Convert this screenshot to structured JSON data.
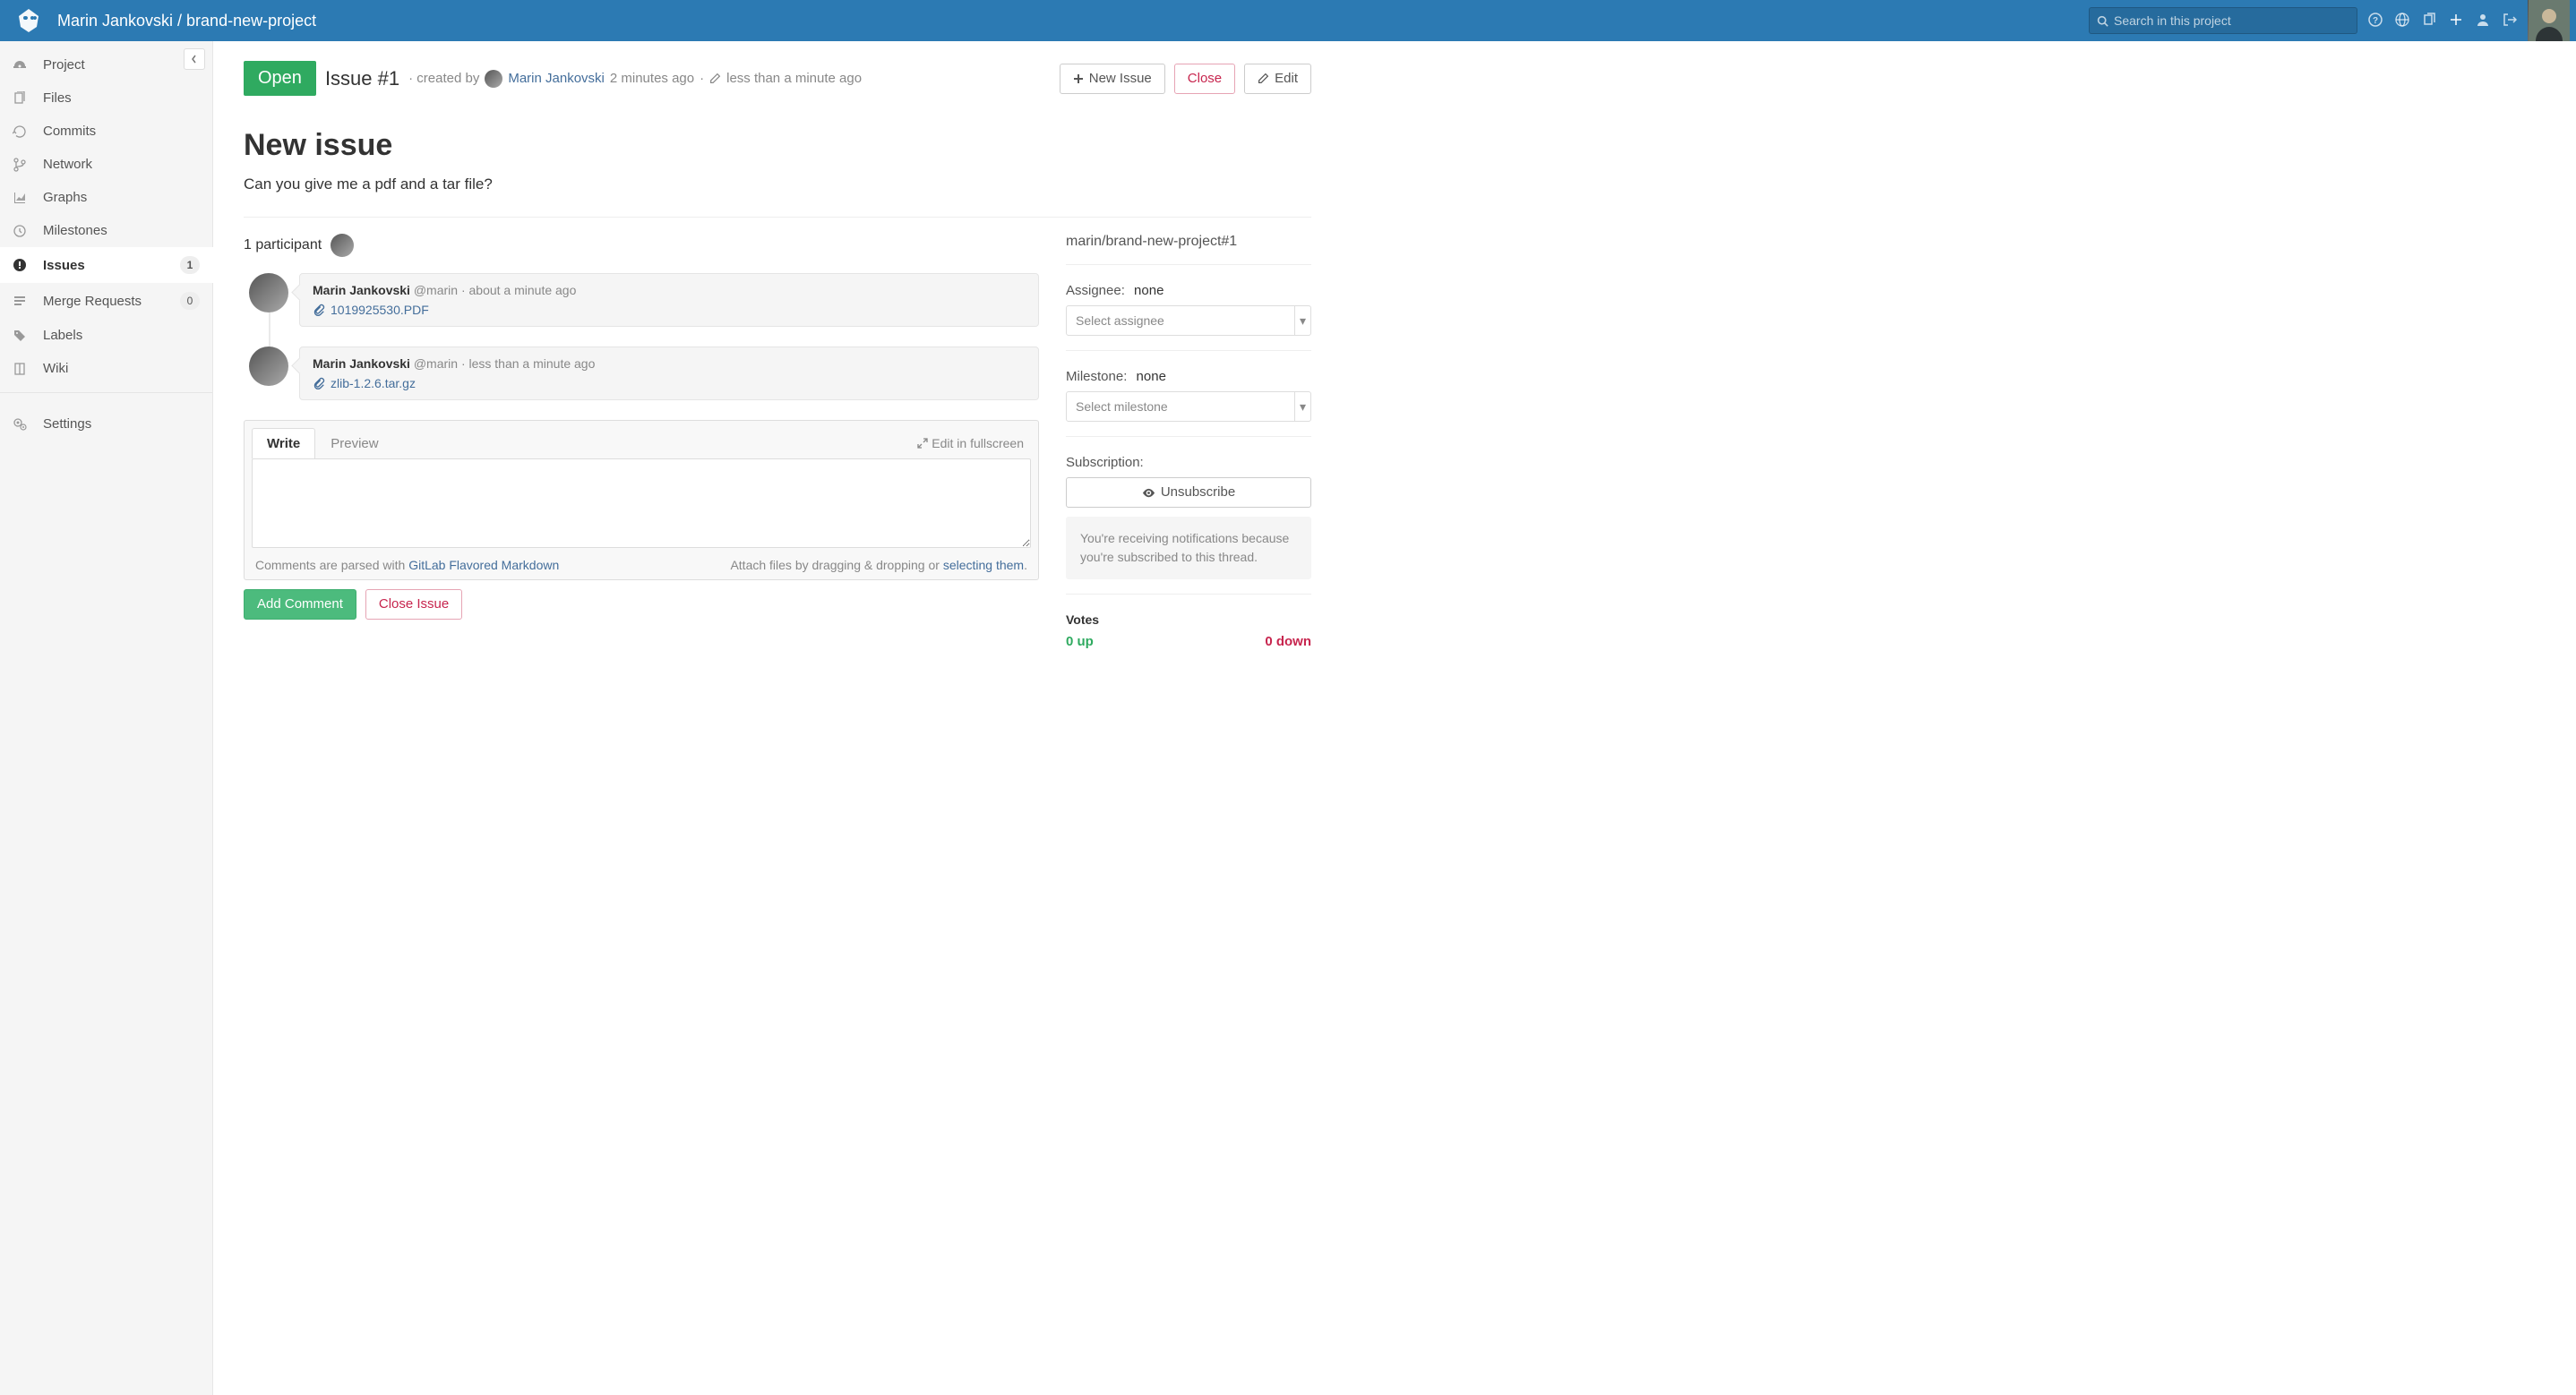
{
  "header": {
    "breadcrumb": "Marin Jankovski / brand-new-project",
    "search_placeholder": "Search in this project"
  },
  "sidebar": {
    "items": [
      {
        "label": "Project",
        "icon": "dashboard-icon"
      },
      {
        "label": "Files",
        "icon": "files-icon"
      },
      {
        "label": "Commits",
        "icon": "history-icon"
      },
      {
        "label": "Network",
        "icon": "branch-icon"
      },
      {
        "label": "Graphs",
        "icon": "chart-icon"
      },
      {
        "label": "Milestones",
        "icon": "clock-icon"
      },
      {
        "label": "Issues",
        "icon": "exclamation-icon",
        "badge": "1",
        "active": true
      },
      {
        "label": "Merge Requests",
        "icon": "merge-icon",
        "badge": "0"
      },
      {
        "label": "Labels",
        "icon": "tags-icon"
      },
      {
        "label": "Wiki",
        "icon": "book-icon"
      }
    ],
    "settings": {
      "label": "Settings",
      "icon": "gears-icon"
    }
  },
  "issue_head": {
    "state": "Open",
    "id": "Issue #1",
    "created_by_prefix": "· created by",
    "author": "Marin Jankovski",
    "created_ago": "2 minutes ago",
    "middot": "·",
    "updated_ago": "less than a minute ago",
    "actions": {
      "new_issue": "New Issue",
      "close": "Close",
      "edit": "Edit"
    }
  },
  "issue": {
    "title": "New issue",
    "description": "Can you give me a pdf and a tar file?"
  },
  "participants": {
    "label": "1 participant"
  },
  "notes": [
    {
      "author": "Marin Jankovski",
      "handle": "@marin",
      "sep": "·",
      "time": "about a minute ago",
      "attachment": "1019925530.PDF"
    },
    {
      "author": "Marin Jankovski",
      "handle": "@marin",
      "sep": "·",
      "time": "less than a minute ago",
      "attachment": "zlib-1.2.6.tar.gz"
    }
  ],
  "comment_box": {
    "tab_write": "Write",
    "tab_preview": "Preview",
    "fullscreen": "Edit in fullscreen",
    "help_prefix": "Comments are parsed with ",
    "help_link": "GitLab Flavored Markdown",
    "attach_prefix": "Attach files by dragging & dropping or ",
    "attach_link": "selecting them",
    "attach_suffix": ".",
    "add": "Add Comment",
    "close": "Close Issue"
  },
  "side": {
    "ref": "marin/brand-new-project#1",
    "assignee_label": "Assignee:",
    "assignee_value": "none",
    "assignee_placeholder": "Select assignee",
    "milestone_label": "Milestone:",
    "milestone_value": "none",
    "milestone_placeholder": "Select milestone",
    "subscription_label": "Subscription:",
    "unsubscribe": "Unsubscribe",
    "notice": "You're receiving notifications because you're subscribed to this thread.",
    "votes_label": "Votes",
    "up": "0 up",
    "down": "0 down"
  }
}
